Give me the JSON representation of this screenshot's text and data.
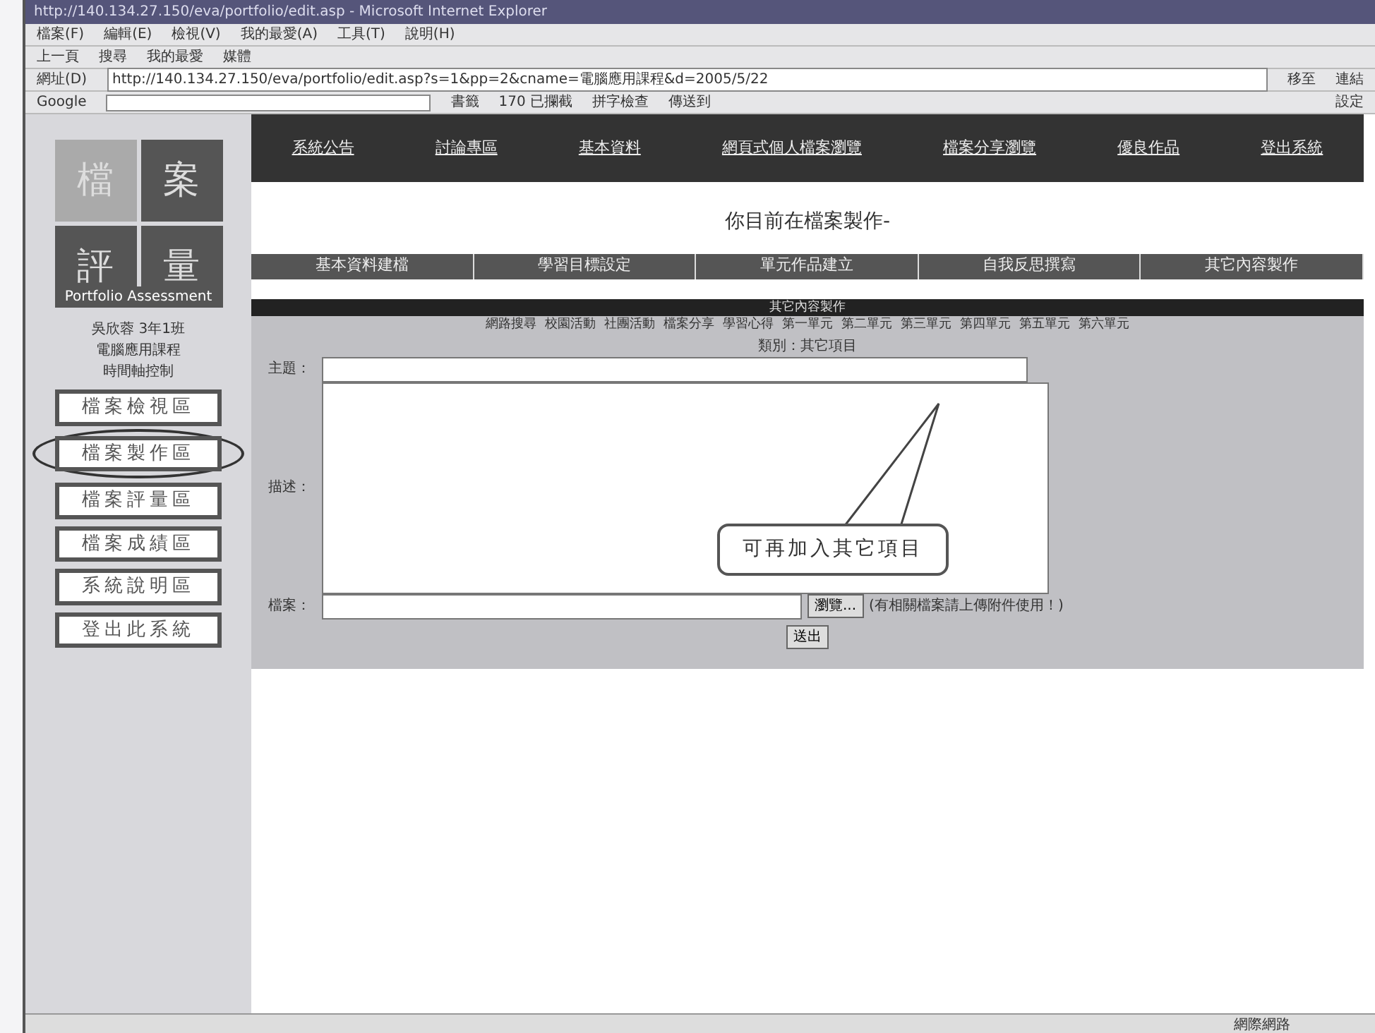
{
  "window": {
    "title": "http://140.134.27.150/eva/portfolio/edit.asp - Microsoft Internet Explorer"
  },
  "menu_bar": [
    "檔案(F)",
    "編輯(E)",
    "檢視(V)",
    "我的最愛(A)",
    "工具(T)",
    "說明(H)"
  ],
  "toolbar": [
    "上一頁",
    "搜尋",
    "我的最愛",
    "媒體"
  ],
  "address_bar": {
    "label": "網址(D)",
    "value": "http://140.134.27.150/eva/portfolio/edit.asp?s=1&pp=2&cname=電腦應用課程&d=2005/5/22",
    "go": "移至",
    "links": "連結"
  },
  "google_bar": {
    "label": "Google",
    "items": [
      "書籤",
      "170 已攔截",
      "拼字檢查",
      "傳送到"
    ],
    "settings": "設定"
  },
  "logo": {
    "chars": [
      "檔",
      "案",
      "評",
      "量"
    ],
    "caption": "Portfolio Assessment"
  },
  "user_info": [
    "吳欣蓉 3年1班",
    "電腦應用課程",
    "時間軸控制"
  ],
  "sidebar": [
    {
      "label": "檔案檢視區",
      "selected": false
    },
    {
      "label": "檔案製作區",
      "selected": true
    },
    {
      "label": "檔案評量區",
      "selected": false
    },
    {
      "label": "檔案成績區",
      "selected": false
    },
    {
      "label": "系統說明區",
      "selected": false
    },
    {
      "label": "登出此系統",
      "selected": false
    }
  ],
  "top_nav": [
    "系統公告",
    "討論專區",
    "基本資料",
    "網頁式個人檔案瀏覽",
    "檔案分享瀏覽",
    "優良作品",
    "登出系統"
  ],
  "heading": "你目前在檔案製作-",
  "tabs": [
    "基本資料建檔",
    "學習目標設定",
    "單元作品建立",
    "自我反思撰寫",
    "其它內容製作"
  ],
  "section_title": "其它內容製作",
  "category_links": [
    "網路搜尋",
    "校園活動",
    "社團活動",
    "檔案分享",
    "學習心得",
    "第一單元",
    "第二單元",
    "第三單元",
    "第四單元",
    "第五單元",
    "第六單元"
  ],
  "category": "類別：其它項目",
  "form": {
    "subject_label": "主題：",
    "description_label": "描述：",
    "file_label": "檔案：",
    "browse": "瀏覽...",
    "file_hint": "(有相關檔案請上傳附件使用！)",
    "submit": "送出"
  },
  "callout": "可再加入其它項目",
  "status_bar": {
    "zone": "網際網路"
  }
}
